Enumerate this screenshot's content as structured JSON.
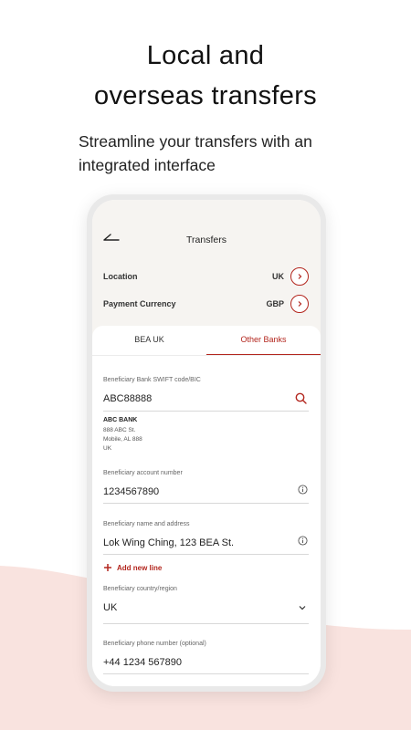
{
  "promo": {
    "title_line1": "Local and",
    "title_line2": "overseas transfers",
    "subtitle_line1": "Streamline your transfers with an",
    "subtitle_line2": "integrated interface"
  },
  "colors": {
    "accent": "#b3261e",
    "background_curve": "#f9e3df",
    "header_bg": "#f6f4f1"
  },
  "app": {
    "nav_title": "Transfers",
    "back_icon": "back-arrow-icon",
    "location": {
      "label": "Location",
      "value": "UK"
    },
    "currency": {
      "label": "Payment Currency",
      "value": "GBP"
    },
    "tabs": [
      {
        "label": "BEA UK",
        "active": false
      },
      {
        "label": "Other Banks",
        "active": true
      }
    ],
    "fields": {
      "swift": {
        "label": "Beneficiary Bank SWIFT code/BIC",
        "value": "ABC88888",
        "icon": "search-icon"
      },
      "bank": {
        "name": "ABC BANK",
        "address_lines": [
          "888 ABC St.",
          "Mobile, AL 888",
          "UK"
        ]
      },
      "account": {
        "label": "Beneficiary account number",
        "value": "1234567890",
        "icon": "info-icon"
      },
      "name_address": {
        "label": "Beneficiary name and address",
        "value": "Lok Wing Ching, 123 BEA St.",
        "icon": "info-icon"
      },
      "add_new_line": "Add new line",
      "country": {
        "label": "Beneficiary country/region",
        "value": "UK",
        "icon": "chevron-down-icon"
      },
      "phone": {
        "label": "Beneficiary phone number (optional)",
        "value": "+44 1234 567890"
      }
    }
  }
}
